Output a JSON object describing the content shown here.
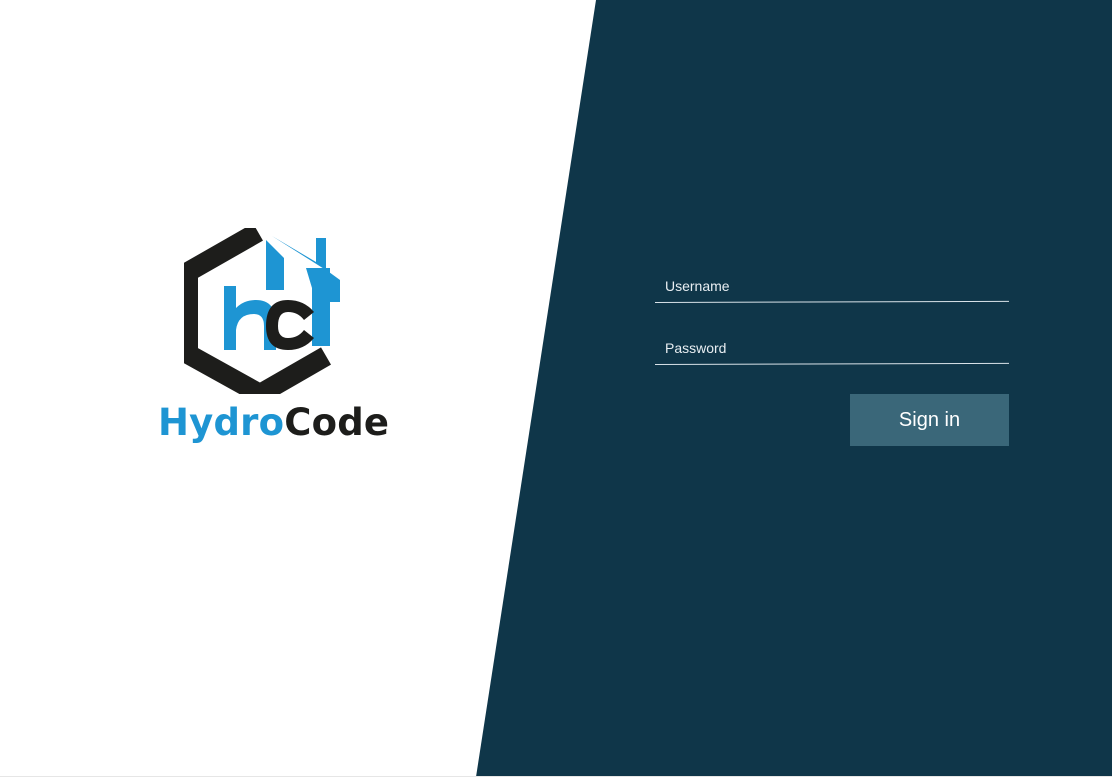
{
  "brand": {
    "logo_initials": "hct",
    "name_part_1": "Hydro",
    "name_part_2": "Code",
    "colors": {
      "blue": "#1e95d3",
      "dark": "#1d1d1b"
    }
  },
  "login": {
    "username_placeholder": "Username",
    "password_placeholder": "Password",
    "username_value": "",
    "password_value": "",
    "signin_label": "Sign in"
  },
  "theme": {
    "panel_background": "#0f3649",
    "button_background": "#3a6779",
    "text_color": "#ffffff"
  }
}
